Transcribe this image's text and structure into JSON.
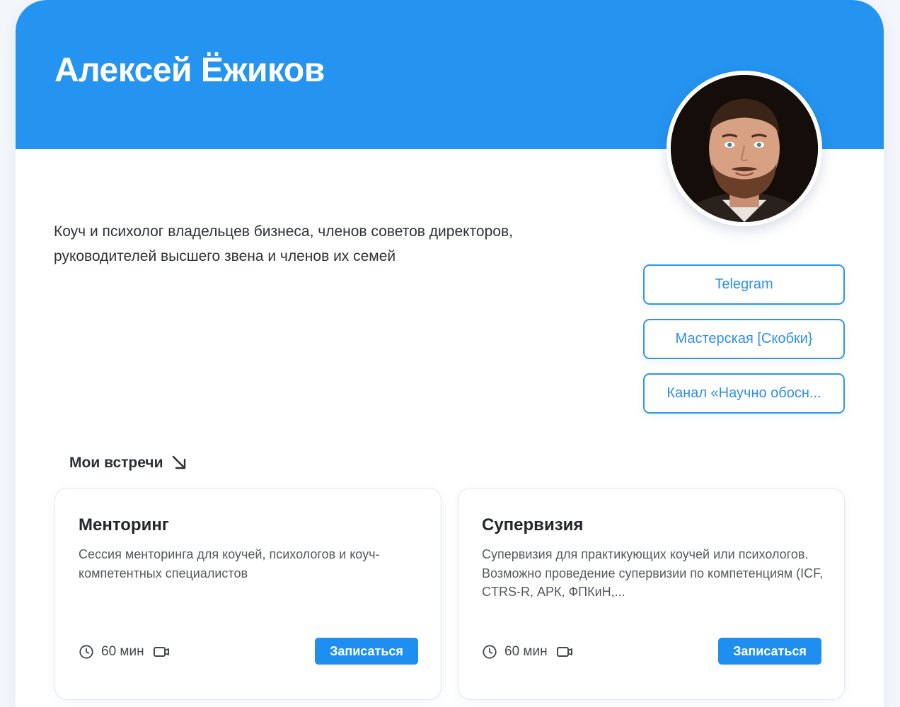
{
  "profile": {
    "name": "Алексей Ёжиков",
    "bio_line1": "Коуч и психолог владельцев бизнеса, членов советов директоров,",
    "bio_line2": "руководителей высшего звена и членов их семей"
  },
  "links": [
    {
      "label": "Telegram"
    },
    {
      "label": "Мастерская [Скобки}"
    },
    {
      "label": "Канал «Научно обосн..."
    }
  ],
  "meetings": {
    "section_title": "Мои встречи",
    "items": [
      {
        "title": "Менторинг",
        "description": "Сессия менторинга для коучей, психологов и коуч-компетентных специалистов",
        "duration": "60 мин",
        "button_label": "Записаться"
      },
      {
        "title": "Супервизия",
        "description": "Супервизия для практикующих коучей или психологов. Возможно проведение супервизии по компетенциям (ICF, CTRS-R, АРК, ФПКиН,...",
        "duration": "60 мин",
        "button_label": "Записаться"
      }
    ]
  },
  "colors": {
    "accent": "#2494f0",
    "button": "#1e8ff0",
    "link_border": "#2f96ee"
  },
  "icons": {
    "section_arrow": "arrow-down-right-icon",
    "duration": "clock-icon",
    "format": "video-camera-icon"
  }
}
